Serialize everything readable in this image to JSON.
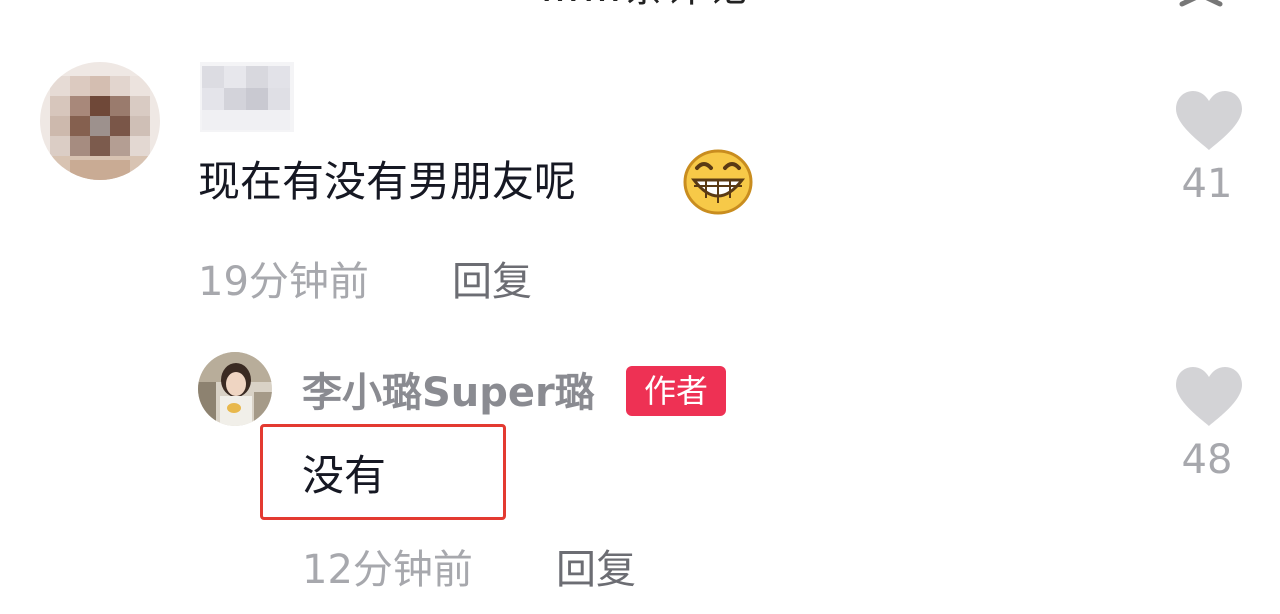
{
  "header": {
    "title": "……条评论"
  },
  "comments": [
    {
      "text": "现在有没有男朋友呢",
      "emoji": "grinning-emoji",
      "time": "19分钟前",
      "reply_label": "回复",
      "likes": "41"
    },
    {
      "author": "李小璐Super璐",
      "badge": "作者",
      "text": "没有",
      "time": "12分钟前",
      "reply_label": "回复",
      "likes": "48"
    }
  ],
  "icons": {
    "close": "close-icon",
    "like": "heart-icon"
  },
  "colors": {
    "badge": "#ee3154",
    "highlight_border": "#e33a31",
    "like_icon": "#d3d3d6",
    "meta_text": "#a7a8ad"
  }
}
